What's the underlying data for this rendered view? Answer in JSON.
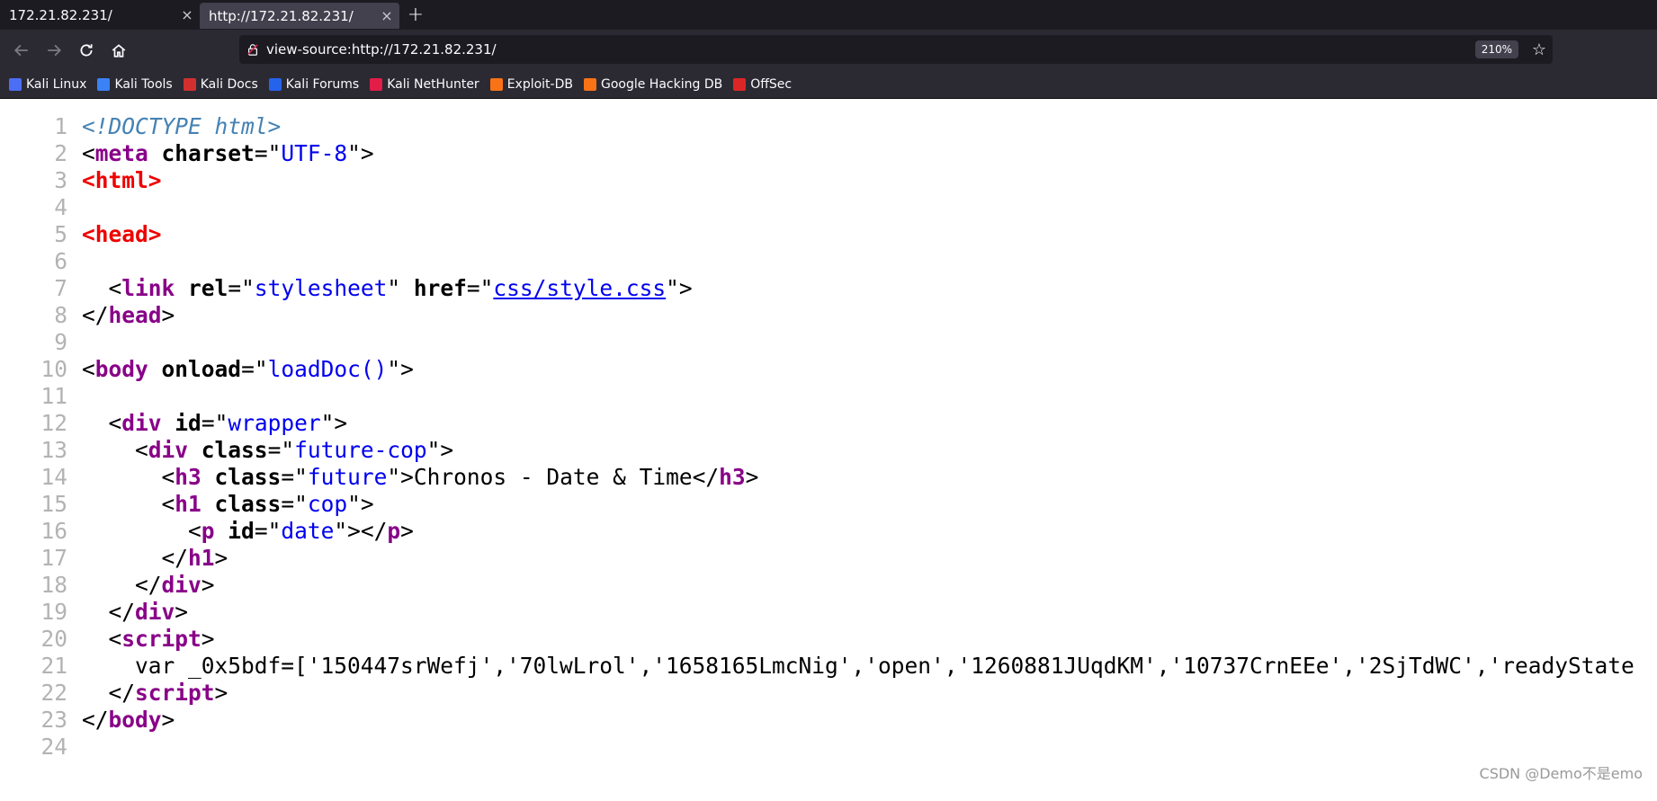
{
  "tabs": [
    {
      "title": "172.21.82.231/",
      "close": "×",
      "active": false
    },
    {
      "title": "http://172.21.82.231/",
      "close": "×",
      "active": true
    }
  ],
  "new_tab": "+",
  "nav": {
    "back": "back-icon",
    "forward": "forward-icon",
    "reload": "reload-icon",
    "home": "home-icon"
  },
  "urlbar": {
    "url": "view-source:http://172.21.82.231/",
    "zoom": "210%",
    "bookmark_star": "☆"
  },
  "bookmarks": [
    {
      "label": "Kali Linux",
      "color": "#4c6ef5"
    },
    {
      "label": "Kali Tools",
      "color": "#3b82f6"
    },
    {
      "label": "Kali Docs",
      "color": "#d32f2f"
    },
    {
      "label": "Kali Forums",
      "color": "#2563eb"
    },
    {
      "label": "Kali NetHunter",
      "color": "#e11d48"
    },
    {
      "label": "Exploit-DB",
      "color": "#f97316"
    },
    {
      "label": "Google Hacking DB",
      "color": "#f97316"
    },
    {
      "label": "OffSec",
      "color": "#dc2626"
    }
  ],
  "source_lines": [
    {
      "n": "1"
    },
    {
      "n": "2"
    },
    {
      "n": "3"
    },
    {
      "n": "4"
    },
    {
      "n": "5"
    },
    {
      "n": "6"
    },
    {
      "n": "7"
    },
    {
      "n": "8"
    },
    {
      "n": "9"
    },
    {
      "n": "10"
    },
    {
      "n": "11"
    },
    {
      "n": "12"
    },
    {
      "n": "13"
    },
    {
      "n": "14"
    },
    {
      "n": "15"
    },
    {
      "n": "16"
    },
    {
      "n": "17"
    },
    {
      "n": "18"
    },
    {
      "n": "19"
    },
    {
      "n": "20"
    },
    {
      "n": "21"
    },
    {
      "n": "22"
    },
    {
      "n": "23"
    },
    {
      "n": "24"
    }
  ],
  "code": {
    "doctype": "<!DOCTYPE html>",
    "meta_tag": "meta",
    "charset_attr": "charset",
    "charset_val": "UTF-8",
    "html_tag": "html",
    "head_tag": "head",
    "link_tag": "link",
    "rel_attr": "rel",
    "rel_val": "stylesheet",
    "href_attr": "href",
    "href_val": "css/style.css",
    "body_tag": "body",
    "onload_attr": "onload",
    "onload_val": "loadDoc()",
    "div_tag": "div",
    "id_attr": "id",
    "wrapper_val": "wrapper",
    "class_attr": "class",
    "future_cop_val": "future-cop",
    "h3_tag": "h3",
    "future_val": "future",
    "h3_text": "Chronos - Date & Time",
    "h1_tag": "h1",
    "cop_val": "cop",
    "p_tag": "p",
    "date_val": "date",
    "script_tag": "script",
    "script_body": "var _0x5bdf=['150447srWefj','70lwLrol','1658165LmcNig','open','1260881JUqdKM','10737CrnEEe','2SjTdWC','readyState"
  },
  "watermark": "CSDN @Demo不是emo"
}
